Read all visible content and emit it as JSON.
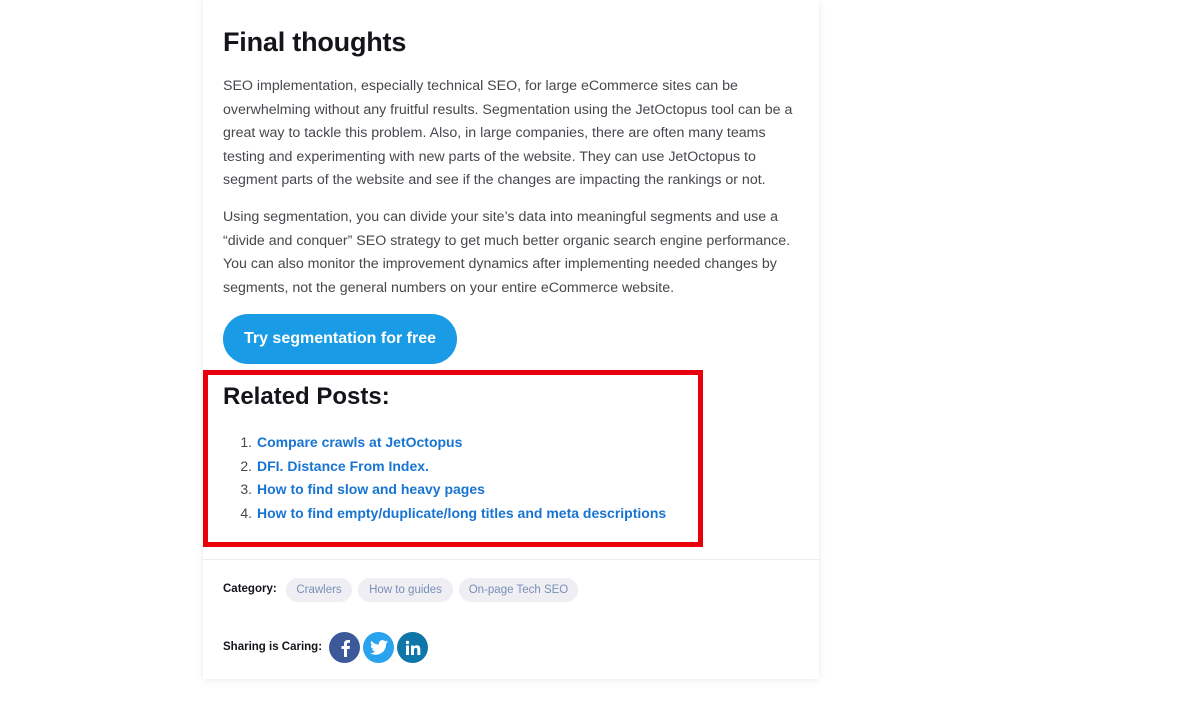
{
  "article": {
    "heading": "Final thoughts",
    "paragraphs": [
      "SEO implementation, especially technical SEO, for large eCommerce sites can be overwhelming without any fruitful results. Segmentation using the JetOctopus tool can be a great way to tackle this problem.  Also, in large companies, there are often many teams testing and experimenting with new parts of the website. They can use JetOctopus to segment parts of the website and see if the changes are impacting the rankings or not.",
      "Using segmentation, you can divide your site’s data into meaningful segments and use a “divide and conquer” SEO strategy to get much better organic search engine performance. You can also monitor the improvement dynamics after implementing needed changes by segments, not the general numbers on your entire eCommerce website."
    ],
    "cta_label": "Try segmentation for free"
  },
  "related": {
    "heading": "Related Posts:",
    "items": [
      {
        "num": "1.",
        "label": "Compare crawls at JetOctopus"
      },
      {
        "num": "2.",
        "label": "DFI. Distance From Index."
      },
      {
        "num": "3.",
        "label": "How to find slow and heavy pages"
      },
      {
        "num": "4.",
        "label": "How to find empty/duplicate/long titles and meta descriptions"
      }
    ]
  },
  "footer": {
    "category_label": "Category:",
    "tags": [
      "Crawlers",
      "How to guides",
      "On-page Tech SEO"
    ],
    "sharing_label": "Sharing is Caring:",
    "social_icons": [
      "facebook-icon",
      "twitter-icon",
      "linkedin-icon"
    ]
  },
  "colors": {
    "accent_button": "#1a9be6",
    "link": "#1874d2",
    "highlight_border": "#e8000b",
    "facebook": "#3c5a99",
    "twitter": "#2aa3ef",
    "linkedin": "#0e76a8"
  }
}
